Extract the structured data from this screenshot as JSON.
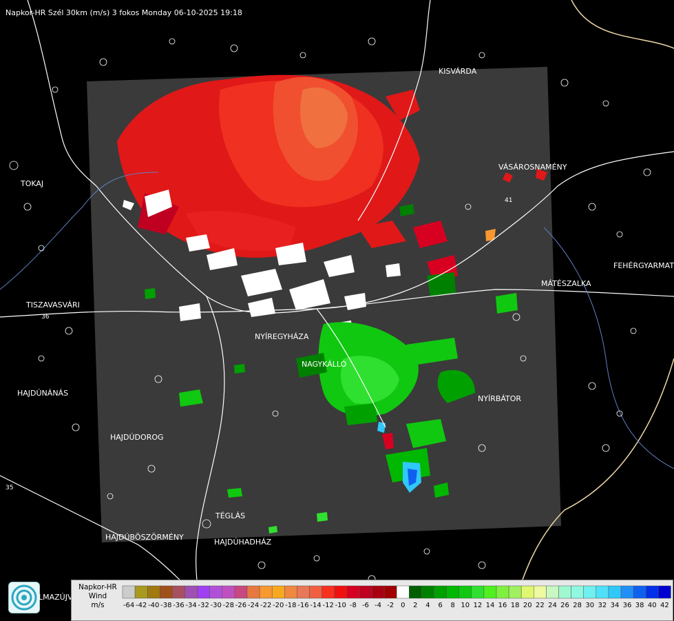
{
  "title": "Napkor-HR Szél 30km (m/s) 3 fokos Monday 06-10-2025 19:18",
  "legend": {
    "line1": "Napkor-HR",
    "line2": "Wind",
    "line3": "m/s",
    "values": [
      "-64",
      "-42",
      "-40",
      "-38",
      "-36",
      "-34",
      "-32",
      "-30",
      "-28",
      "-26",
      "-24",
      "-22",
      "-20",
      "-18",
      "-16",
      "-14",
      "-12",
      "-10",
      "-8",
      "-6",
      "-4",
      "-2",
      "0",
      "2",
      "4",
      "6",
      "8",
      "10",
      "12",
      "14",
      "16",
      "18",
      "20",
      "22",
      "24",
      "26",
      "28",
      "30",
      "32",
      "34",
      "36",
      "38",
      "40",
      "42"
    ],
    "colors": [
      "#cccccc",
      "#a89a1e",
      "#a07a10",
      "#a0501a",
      "#a85060",
      "#a050b0",
      "#a040f0",
      "#b050d8",
      "#c050c0",
      "#c84880",
      "#e87840",
      "#f89830",
      "#f8a820",
      "#f08840",
      "#e87858",
      "#f06040",
      "#f83020",
      "#f01010",
      "#d80020",
      "#c00020",
      "#a80010",
      "#a00000",
      "#ffffff",
      "#006000",
      "#008000",
      "#00a000",
      "#00b800",
      "#10c810",
      "#30e030",
      "#50f020",
      "#80f040",
      "#a0f060",
      "#e0f870",
      "#f0f8a0",
      "#c8f8c0",
      "#a0f8d0",
      "#90f8e0",
      "#70f0f0",
      "#50e0f8",
      "#30c8f8",
      "#2090f8",
      "#1060f0",
      "#0030e8",
      "#0000d0"
    ]
  },
  "cities": [
    {
      "name": "KISVÁRDA"
    },
    {
      "name": "VÁSÁROSNAMÉNY"
    },
    {
      "name": "TOKAJ"
    },
    {
      "name": "FEHÉRGYARMAT"
    },
    {
      "name": "MÁTÉSZALKA"
    },
    {
      "name": "TISZAVASVÁRI"
    },
    {
      "name": "NYÍREGYHÁZA"
    },
    {
      "name": "NAGYKÁLLÓ"
    },
    {
      "name": "NYÍRBÁTOR"
    },
    {
      "name": "HAJDÚNÁNÁS"
    },
    {
      "name": "HAJDÚDOROG"
    },
    {
      "name": "TÉGLÁS"
    },
    {
      "name": "HAJDÚBÖSZÖRMÉNY"
    },
    {
      "name": "HAJDÚHADHÁZ"
    }
  ],
  "roads": [
    {
      "label": "41"
    },
    {
      "label": "36"
    },
    {
      "label": "35"
    }
  ],
  "logo_text": "LMAZÚJVÁROS"
}
